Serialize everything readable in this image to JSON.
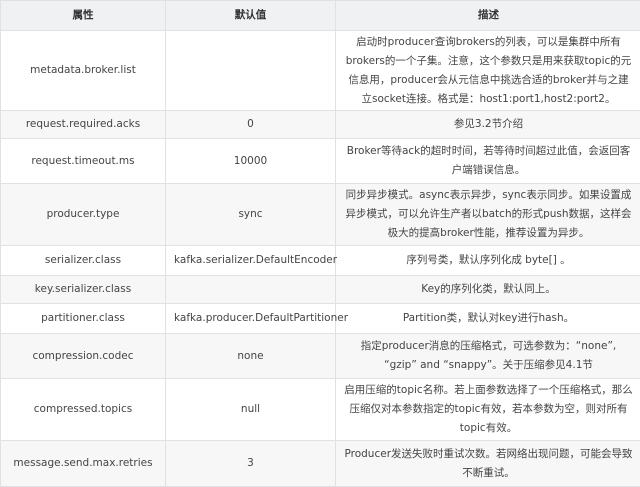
{
  "headers": [
    "属性",
    "默认值",
    "描述"
  ],
  "rows": [
    {
      "name": "metadata.broker.list",
      "default": "",
      "desc": "启动时producer查询brokers的列表，可以是集群中所有brokers的一个子集。注意，这个参数只是用来获取topic的元信息用，producer会从元信息中挑选合适的broker并与之建立socket连接。格式是：host1:port1,host2:port2。"
    },
    {
      "name": "request.required.acks",
      "default": "0",
      "desc": "参见3.2节介绍"
    },
    {
      "name": "request.timeout.ms",
      "default": "10000",
      "desc": "Broker等待ack的超时时间，若等待时间超过此值，会返回客户端错误信息。"
    },
    {
      "name": "producer.type",
      "default": "sync",
      "desc": "同步异步模式。async表示异步，sync表示同步。如果设置成异步模式，可以允许生产者以batch的形式push数据，这样会极大的提高broker性能，推荐设置为异步。"
    },
    {
      "name": "serializer.class",
      "default": "kafka.serializer.DefaultEncoder",
      "desc": "序列号类，默认序列化成 byte[] 。"
    },
    {
      "name": "key.serializer.class",
      "default": "",
      "desc": "Key的序列化类，默认同上。"
    },
    {
      "name": "partitioner.class",
      "default": "kafka.producer.DefaultPartitioner",
      "desc": "Partition类，默认对key进行hash。"
    },
    {
      "name": "compression.codec",
      "default": "none",
      "desc": "指定producer消息的压缩格式，可选参数为：“none”, “gzip” and “snappy”。关于压缩参见4.1节"
    },
    {
      "name": "compressed.topics",
      "default": "null",
      "desc": "启用压缩的topic名称。若上面参数选择了一个压缩格式，那么压缩仅对本参数指定的topic有效，若本参数为空，则对所有topic有效。"
    },
    {
      "name": "message.send.max.retries",
      "default": "3",
      "desc": "Producer发送失败时重试次数。若网络出现问题，可能会导致不断重试。"
    }
  ]
}
